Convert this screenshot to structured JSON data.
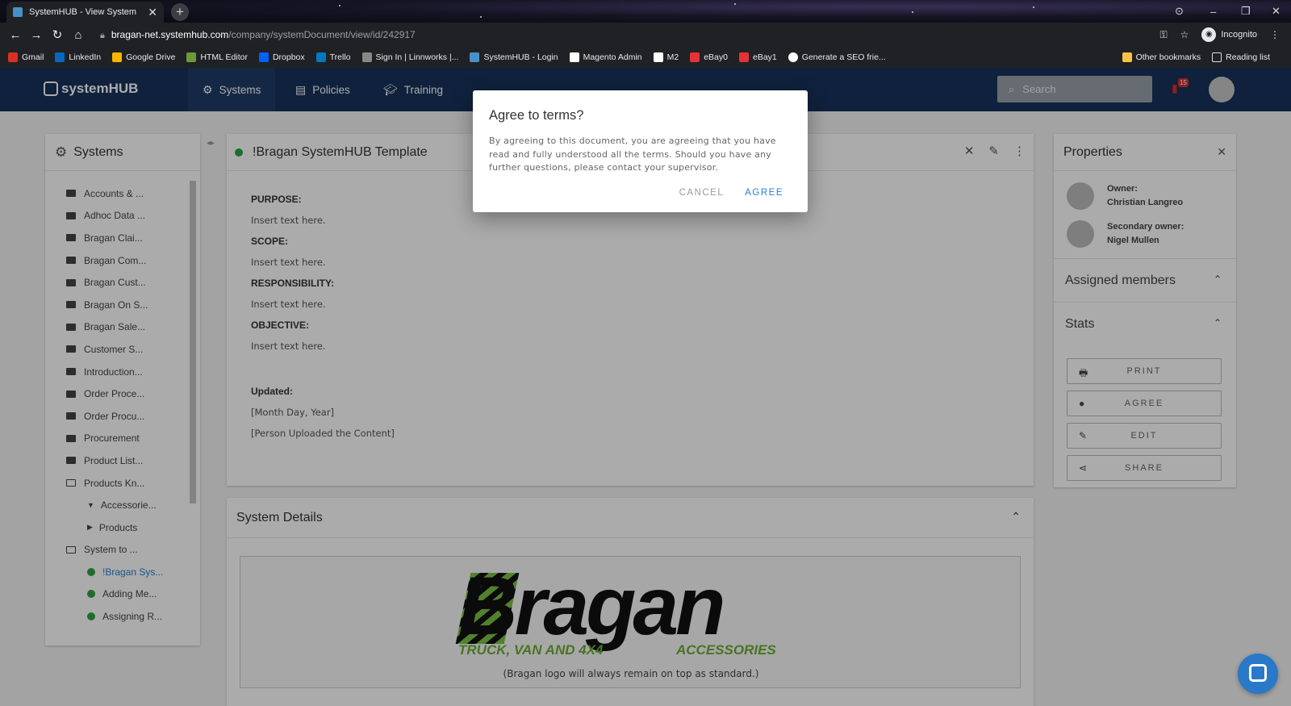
{
  "browser": {
    "tab_title": "SystemHUB - View System",
    "url_domain": "bragan-net.systemhub.com",
    "url_path": "/company/systemDocument/view/id/242917",
    "incognito_label": "Incognito",
    "bookmarks": [
      {
        "label": "Gmail",
        "color": "#d93025"
      },
      {
        "label": "LinkedIn",
        "color": "#0a66c2"
      },
      {
        "label": "Google Drive",
        "color": "#f4b400"
      },
      {
        "label": "HTML Editor",
        "color": "#6a9a3a"
      },
      {
        "label": "Dropbox",
        "color": "#0061ff"
      },
      {
        "label": "Trello",
        "color": "#0079bf"
      },
      {
        "label": "Sign In | Linnworks |...",
        "color": "#888888"
      },
      {
        "label": "SystemHUB - Login",
        "color": "#4a90c8"
      },
      {
        "label": "Magento Admin",
        "color": "#ffffff"
      },
      {
        "label": "M2",
        "color": "#ffffff"
      },
      {
        "label": "eBay0",
        "color": "#e53238"
      },
      {
        "label": "eBay1",
        "color": "#e53238"
      },
      {
        "label": "Generate a SEO frie...",
        "color": "#ffffff"
      }
    ],
    "other_bookmarks": "Other bookmarks",
    "reading_list": "Reading list"
  },
  "app": {
    "logo": "systemHUB",
    "nav": [
      {
        "label": "Systems",
        "icon": "gear-icon"
      },
      {
        "label": "Policies",
        "icon": "document-icon"
      },
      {
        "label": "Training",
        "icon": "graduation-cap-icon"
      }
    ],
    "search_placeholder": "Search",
    "notification_count": "15"
  },
  "sidebar": {
    "title": "Systems",
    "items": [
      {
        "label": "Accounts & ..."
      },
      {
        "label": "Adhoc Data ..."
      },
      {
        "label": "Bragan Clai..."
      },
      {
        "label": "Bragan Com..."
      },
      {
        "label": "Bragan Cust..."
      },
      {
        "label": "Bragan On S..."
      },
      {
        "label": "Bragan Sale..."
      },
      {
        "label": "Customer S..."
      },
      {
        "label": "Introduction..."
      },
      {
        "label": "Order Proce..."
      },
      {
        "label": "Order Procu..."
      },
      {
        "label": "Procurement"
      },
      {
        "label": "Product List..."
      },
      {
        "label": "Products Kn..."
      },
      {
        "label": "Accessorie..."
      },
      {
        "label": "Products"
      },
      {
        "label": "System to ..."
      },
      {
        "label": "!Bragan Sys..."
      },
      {
        "label": "Adding Me..."
      },
      {
        "label": "Assigning R..."
      }
    ]
  },
  "document": {
    "title": "!Bragan SystemHUB Template",
    "sections": [
      {
        "heading": "PURPOSE:",
        "text": "Insert text here."
      },
      {
        "heading": "SCOPE:",
        "text": "Insert text here."
      },
      {
        "heading": "RESPONSIBILITY:",
        "text": "Insert text here."
      },
      {
        "heading": "OBJECTIVE:",
        "text": "Insert text here."
      }
    ],
    "updated_label": "Updated:",
    "updated_date": "[Month Day, Year]",
    "updated_person": "[Person Uploaded the Content]"
  },
  "details": {
    "title": "System Details",
    "brand_word": "Bragan",
    "brand_tag_left": "TRUCK, VAN AND 4X4",
    "brand_tag_right": "ACCESSORIES",
    "caption": "(Bragan logo will always remain on top as standard.)"
  },
  "properties": {
    "title": "Properties",
    "owner_label": "Owner:",
    "owner_name": "Christian Langreo",
    "secondary_label": "Secondary owner:",
    "secondary_name": "Nigel Mullen",
    "assigned_members": "Assigned members",
    "stats": "Stats",
    "buttons": {
      "print": "PRINT",
      "agree": "AGREE",
      "edit": "EDIT",
      "share": "SHARE"
    }
  },
  "dialog": {
    "title": "Agree to terms?",
    "body": "By agreeing to this document, you are agreeing that you have read and fully understood all the terms. Should you have any further questions, please contact your supervisor.",
    "cancel": "CANCEL",
    "agree": "AGREE"
  }
}
